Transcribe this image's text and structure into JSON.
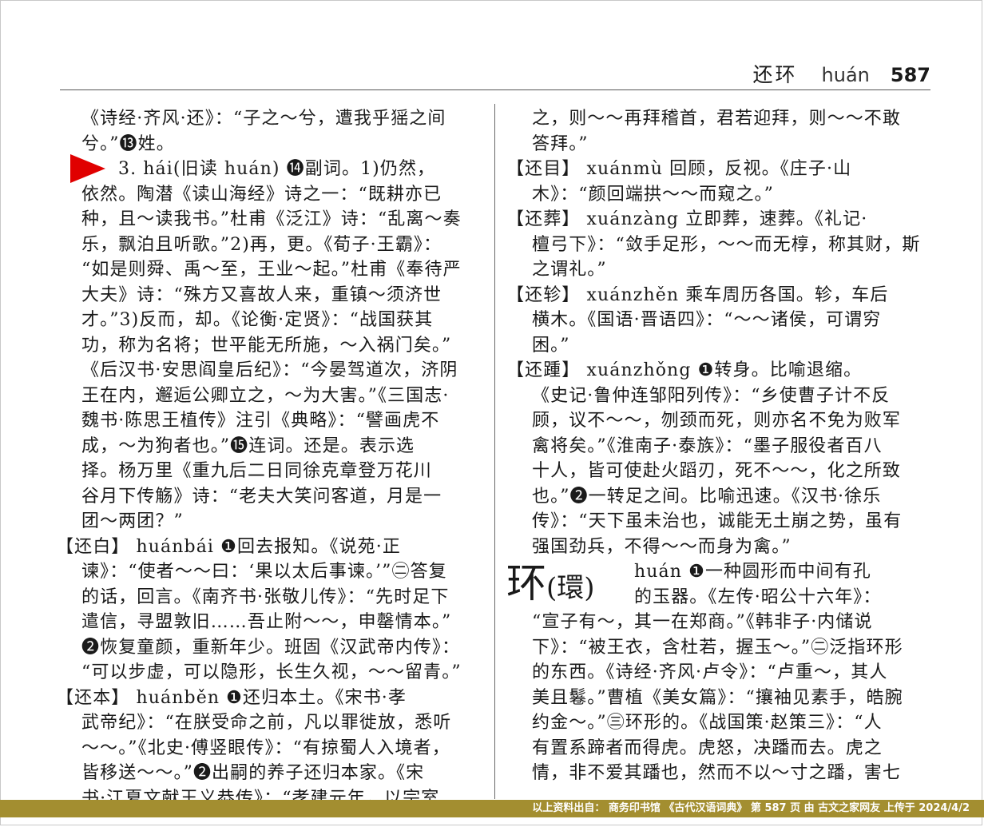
{
  "header": {
    "headwords": "还环",
    "pinyin": "huán",
    "page_number": "587"
  },
  "left_column": [
    {
      "t": "《诗经·齐风·还》：“子之～兮，遭我乎猺之间",
      "c": "ind"
    },
    {
      "t": "兮。”⓭姓。",
      "c": "ind"
    },
    {
      "t": "3. hái(旧读 huán)  ⓮副词。1)仍然，",
      "c": "ind2"
    },
    {
      "t": "依然。陶潜《读山海经》诗之一：“既耕亦已",
      "c": "ind"
    },
    {
      "t": "种，且～读我书。”杜甫《泛江》诗：“乱离～奏",
      "c": "ind"
    },
    {
      "t": "乐，飘泊且听歌。”2)再，更。《荀子·王霸》：",
      "c": "ind"
    },
    {
      "t": "“如是则舜、禹～至，王业～起。”杜甫《奉待严",
      "c": "ind"
    },
    {
      "t": "大夫》诗：“殊方又喜故人来，重镇～须济世",
      "c": "ind"
    },
    {
      "t": "才。”3)反而，却。《论衡·定贤》：“战国获其",
      "c": "ind"
    },
    {
      "t": "功，称为名将；世平能无所施，～入祸门矣。”",
      "c": "ind"
    },
    {
      "t": "《后汉书·安思阎皇后纪》：“今晏驾道次，济阴",
      "c": "ind"
    },
    {
      "t": "王在内，邂逅公卿立之，～为大害。”《三国志·",
      "c": "ind"
    },
    {
      "t": "魏书·陈思王植传》注引《典略》：“譬画虎不",
      "c": "ind"
    },
    {
      "t": "成，～为狗者也。”⓯连词。还是。表示选",
      "c": "ind"
    },
    {
      "t": "择。杨万里《重九后二日同徐克章登万花川",
      "c": "ind"
    },
    {
      "t": "谷月下传觞》诗：“老夫大笑问客道，月是一",
      "c": "ind"
    },
    {
      "t": "团～两团？”",
      "c": "ind"
    },
    {
      "t": "【还白】 huánbái  ❶回去报知。《说苑·正",
      "c": "hw"
    },
    {
      "t": "谏》：“使者～～曰：‘果以太后事谏。’”㊁答复",
      "c": "ind"
    },
    {
      "t": "的话，回言。《南齐书·张敬儿传》：“先时足下",
      "c": "ind"
    },
    {
      "t": "遣信，寻盟敦旧……吾止附～～，申罄情本。”",
      "c": "ind"
    },
    {
      "t": "❷恢复童颜，重新年少。班固《汉武帝内传》：",
      "c": "ind"
    },
    {
      "t": "“可以步虚，可以隐形，长生久视，～～留青。”",
      "c": "ind"
    },
    {
      "t": "【还本】 huánběn  ❶还归本土。《宋书·孝",
      "c": "hw"
    },
    {
      "t": "武帝纪》：“在朕受命之前，凡以罪徙放，悉听",
      "c": "ind"
    },
    {
      "t": "～～。”《北史·傅竖眼传》：“有掠蜀人入境者，",
      "c": "ind"
    },
    {
      "t": "皆移送～～。”❷出嗣的养子还归本家。《宋",
      "c": "ind"
    },
    {
      "t": "书·江夏文献王义恭传》：“孝建元年，以宗室",
      "c": "ind"
    }
  ],
  "right_column": [
    {
      "t": "之，则～～再拜稽首，君若迎拜，则～～不敢",
      "c": "ind"
    },
    {
      "t": "答拜。”",
      "c": "ind"
    },
    {
      "t": "【还目】 xuánmù  回顾，反视。《庄子·山",
      "c": "hw"
    },
    {
      "t": "木》：“颜回端拱～～而窥之。”",
      "c": "ind"
    },
    {
      "t": "【还葬】 xuánzàng  立即葬，速葬。《礼记·",
      "c": "hw"
    },
    {
      "t": "檀弓下》：“敛手足形，～～而无椁，称其财，斯",
      "c": "ind"
    },
    {
      "t": "之谓礼。”",
      "c": "ind"
    },
    {
      "t": "【还轸】 xuánzhěn  乘车周历各国。轸，车后",
      "c": "hw"
    },
    {
      "t": "横木。《国语·晋语四》：“～～诸侯，可谓穷",
      "c": "ind"
    },
    {
      "t": "困。”",
      "c": "ind"
    },
    {
      "t": "【还踵】 xuánzhǒng  ❶转身。比喻退缩。",
      "c": "hw"
    },
    {
      "t": "《史记·鲁仲连邹阳列传》：“乡使曹子计不反",
      "c": "ind"
    },
    {
      "t": "顾，议不～～，刎颈而死，则亦名不免为败军",
      "c": "ind"
    },
    {
      "t": "禽将矣。”《淮南子·泰族》：“墨子服役者百八",
      "c": "ind"
    },
    {
      "t": "十人，皆可使赴火蹈刃，死不～～，化之所致",
      "c": "ind"
    },
    {
      "t": "也。”❷一转足之间。比喻迅速。《汉书·徐乐",
      "c": "ind"
    },
    {
      "t": "传》：“天下虽未治也，诚能无土崩之势，虽有",
      "c": "ind"
    },
    {
      "t": "强国劲兵，不得～～而身为禽。”",
      "c": "ind"
    }
  ],
  "right_big_entry": {
    "char": "环",
    "trad": "(環)",
    "line1": "huán  ❶一种圆形而中间有孔",
    "line2": "的玉器。《左传·昭公十六年》："
  },
  "right_column_after": [
    {
      "t": "“宣子有～，其一在郑商。”《韩非子·内储说",
      "c": "ind"
    },
    {
      "t": "下》：“被王衣，含杜若，握玉～。”㊁泛指环形",
      "c": "ind"
    },
    {
      "t": "的东西。《诗经·齐风·卢令》：“卢重～，其人",
      "c": "ind"
    },
    {
      "t": "美且鬈。”曹植《美女篇》：“攘袖见素手，皓腕",
      "c": "ind"
    },
    {
      "t": "约金～。”㊂环形的。《战国策·赵策三》：“人",
      "c": "ind"
    },
    {
      "t": "有置系蹄者而得虎。虎怒，决蹯而去。虎之",
      "c": "ind"
    },
    {
      "t": "情，非不爱其蹯也，然而不以～寸之蹯，害七",
      "c": "ind"
    }
  ],
  "footer": {
    "text": "以上资料出自：  商务印书馆    《古代汉语词典》    第  587  页 由  古文之家网友  上传于   2024/4/2"
  },
  "colors": {
    "footer_bg": "#a38e30",
    "arrow": "#e00000"
  }
}
